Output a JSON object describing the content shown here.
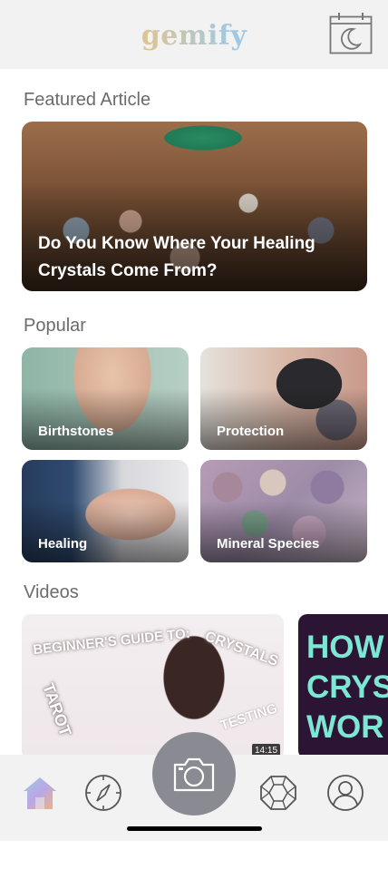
{
  "header": {
    "logo": "gemify",
    "calendar_icon": "calendar-moon-icon"
  },
  "sections": {
    "featured_title": "Featured Article",
    "popular_title": "Popular",
    "videos_title": "Videos"
  },
  "featured_article": {
    "title": "Do You Know Where Your Healing Crystals Come From?"
  },
  "popular": [
    {
      "label": "Birthstones"
    },
    {
      "label": "Protection"
    },
    {
      "label": "Healing"
    },
    {
      "label": "Mineral Species"
    }
  ],
  "videos": [
    {
      "overlay_text": [
        "BEGINNER'S GUIDE TO:",
        "CRYSTALS",
        "TAROT",
        "TESTING"
      ],
      "duration": "14:15"
    },
    {
      "overlay_text": [
        "HOW",
        "CRYS",
        "WOR"
      ]
    }
  ],
  "nav": {
    "items": [
      "home-icon",
      "compass-icon",
      "camera-icon",
      "gem-icon",
      "profile-icon"
    ]
  },
  "colors": {
    "accent_teal": "#7ee6d4",
    "nav_bg": "#f2f2f2",
    "camera_bg": "#8a8a93"
  }
}
